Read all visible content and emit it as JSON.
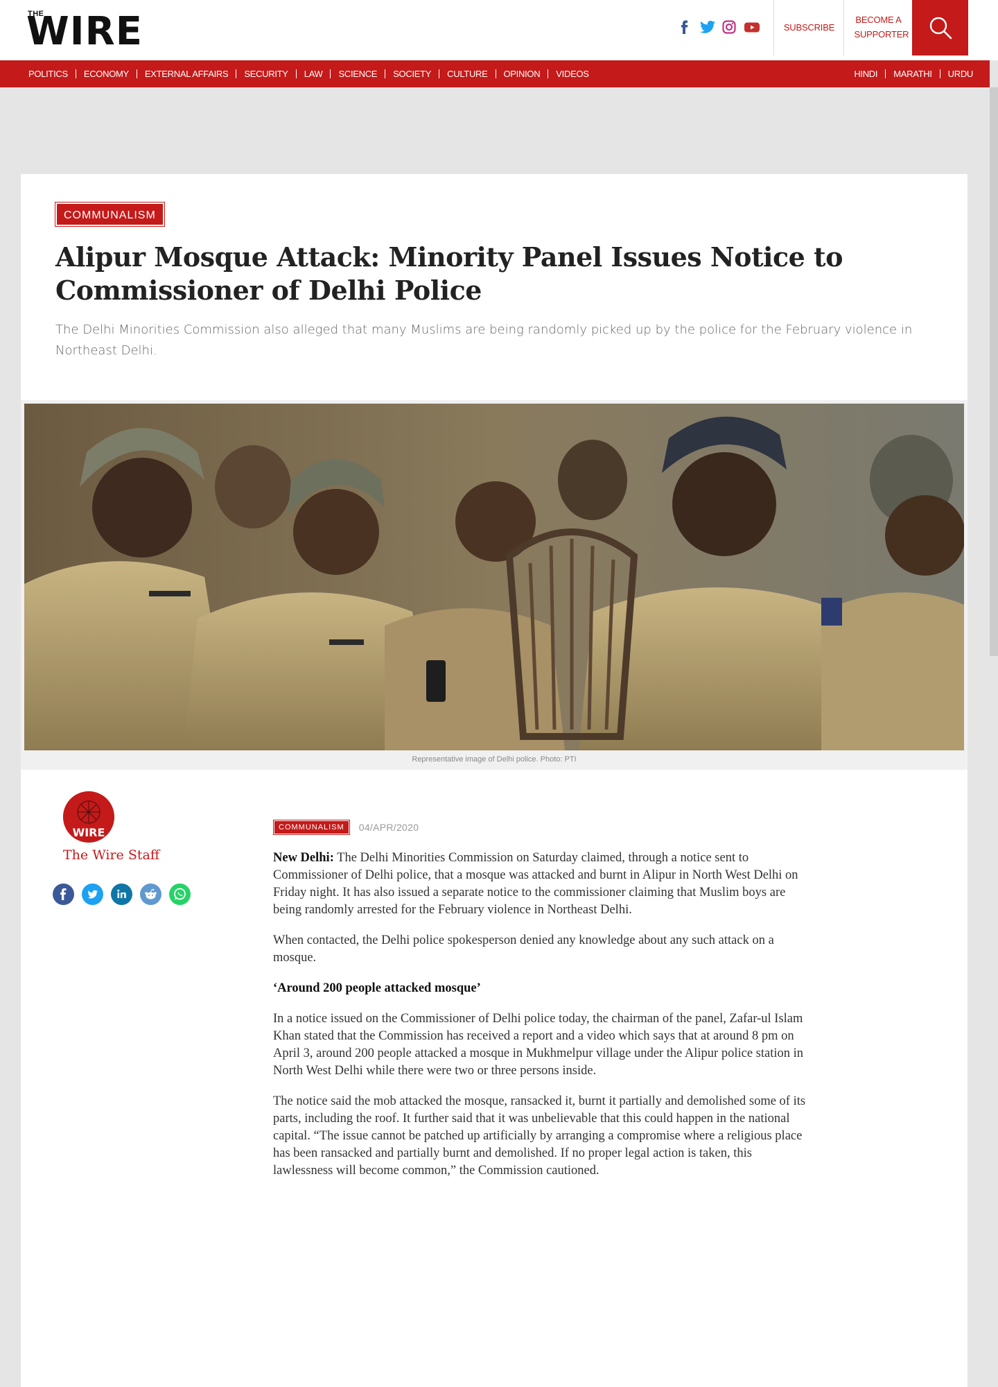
{
  "header": {
    "logo_small": "THE",
    "logo_big": "WIRE",
    "subscribe": "SUBSCRIBE",
    "become_supporter": "BECOME A SUPPORTER",
    "social": [
      "facebook-icon",
      "twitter-icon",
      "instagram-icon",
      "youtube-icon"
    ]
  },
  "nav": {
    "main": [
      "POLITICS",
      "ECONOMY",
      "EXTERNAL AFFAIRS",
      "SECURITY",
      "LAW",
      "SCIENCE",
      "SOCIETY",
      "CULTURE",
      "OPINION",
      "VIDEOS"
    ],
    "langs": [
      "HINDI",
      "MARATHI",
      "URDU"
    ]
  },
  "article": {
    "category": "COMMUNALISM",
    "headline": "Alipur Mosque Attack: Minority Panel Issues Notice to Commissioner of Delhi Police",
    "dek": "The Delhi Minorities Commission also alleged that many Muslims are being randomly picked up by the police for the February violence in Northeast Delhi.",
    "caption": "Representative image of Delhi police. Photo: PTI",
    "author": "The Wire Staff",
    "meta_tag": "COMMUNALISM",
    "date": "04/APR/2020",
    "dateline": "New Delhi:",
    "p1": " The Delhi Minorities Commission on Saturday claimed, through a notice sent to Commissioner of Delhi police, that a mosque was attacked and burnt in Alipur in North West Delhi on Friday night. It has also issued a separate notice to the commissioner claiming that Muslim boys are being randomly arrested for the February violence in Northeast Delhi.",
    "p2": "When contacted, the Delhi police spokesperson denied any knowledge about any such attack on a mosque.",
    "subhead": "‘Around 200 people attacked mosque’",
    "p3": "In a notice issued on the Commissioner of Delhi police today, the chairman of the panel, Zafar-ul Islam Khan stated that the Commission has received a report and a video which says that at around 8 pm on April 3, around 200 people attacked a mosque in Mukhmelpur village under the Alipur police station in North West Delhi while there were two or three persons inside.",
    "p4": "The notice said the mob attacked the mosque, ransacked it, burnt it partially and demolished some of its parts, including the roof. It further said that it was unbelievable that this could happen in the national capital. “The issue cannot be patched up artificially by arranging a compromise where a religious place has been ransacked and partially burnt and demolished. If no proper legal action is taken, this lawlessness will become common,” the Commission cautioned.",
    "shares": [
      "facebook-share-icon",
      "twitter-share-icon",
      "linkedin-share-icon",
      "reddit-share-icon",
      "whatsapp-share-icon"
    ]
  },
  "colors": {
    "brand": "#c41a1a"
  }
}
